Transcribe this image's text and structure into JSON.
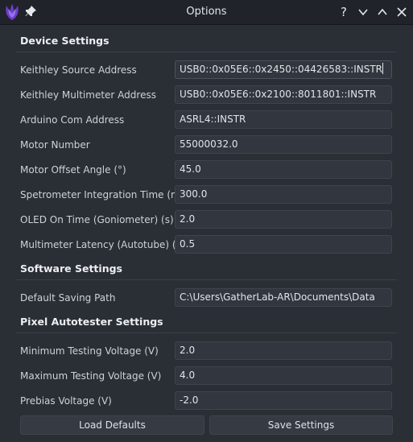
{
  "window": {
    "title": "Options"
  },
  "device": {
    "heading": "Device Settings",
    "rows": [
      {
        "label": "Keithley Source Address",
        "value": "USB0::0x05E6::0x2450::04426583::INSTR"
      },
      {
        "label": "Keithley Multimeter Address",
        "value": "USB0::0x05E6::0x2100::8011801::INSTR"
      },
      {
        "label": "Arduino Com Address",
        "value": "ASRL4::INSTR"
      },
      {
        "label": "Motor Number",
        "value": "55000032.0"
      },
      {
        "label": "Motor Offset Angle (°)",
        "value": "45.0"
      },
      {
        "label": "Spetrometer Integration Time (ms)",
        "value": "300.0"
      },
      {
        "label": "OLED On Time (Goniometer) (s)",
        "value": "2.0"
      },
      {
        "label": "Multimeter Latency (Autotube) (s)",
        "value": "0.5"
      }
    ]
  },
  "software": {
    "heading": "Software Settings",
    "rows": [
      {
        "label": "Default Saving Path",
        "value": "C:\\Users\\GatherLab-AR\\Documents\\Data"
      }
    ]
  },
  "pixel": {
    "heading": "Pixel Autotester Settings",
    "rows": [
      {
        "label": "Minimum Testing Voltage (V)",
        "value": "2.0"
      },
      {
        "label": "Maximum Testing Voltage (V)",
        "value": "4.0"
      },
      {
        "label": "Prebias Voltage (V)",
        "value": "-2.0"
      }
    ]
  },
  "buttons": {
    "load_defaults": "Load Defaults",
    "save_settings": "Save Settings"
  },
  "icons": {
    "app": "app-logo-icon",
    "pin": "pin-icon",
    "help": "help-icon",
    "minimize": "chevron-down-icon",
    "maximize": "chevron-up-icon",
    "close": "close-icon"
  },
  "colors": {
    "accent": "#6a3fc8",
    "background": "#2a2e35",
    "field": "#31363f"
  }
}
